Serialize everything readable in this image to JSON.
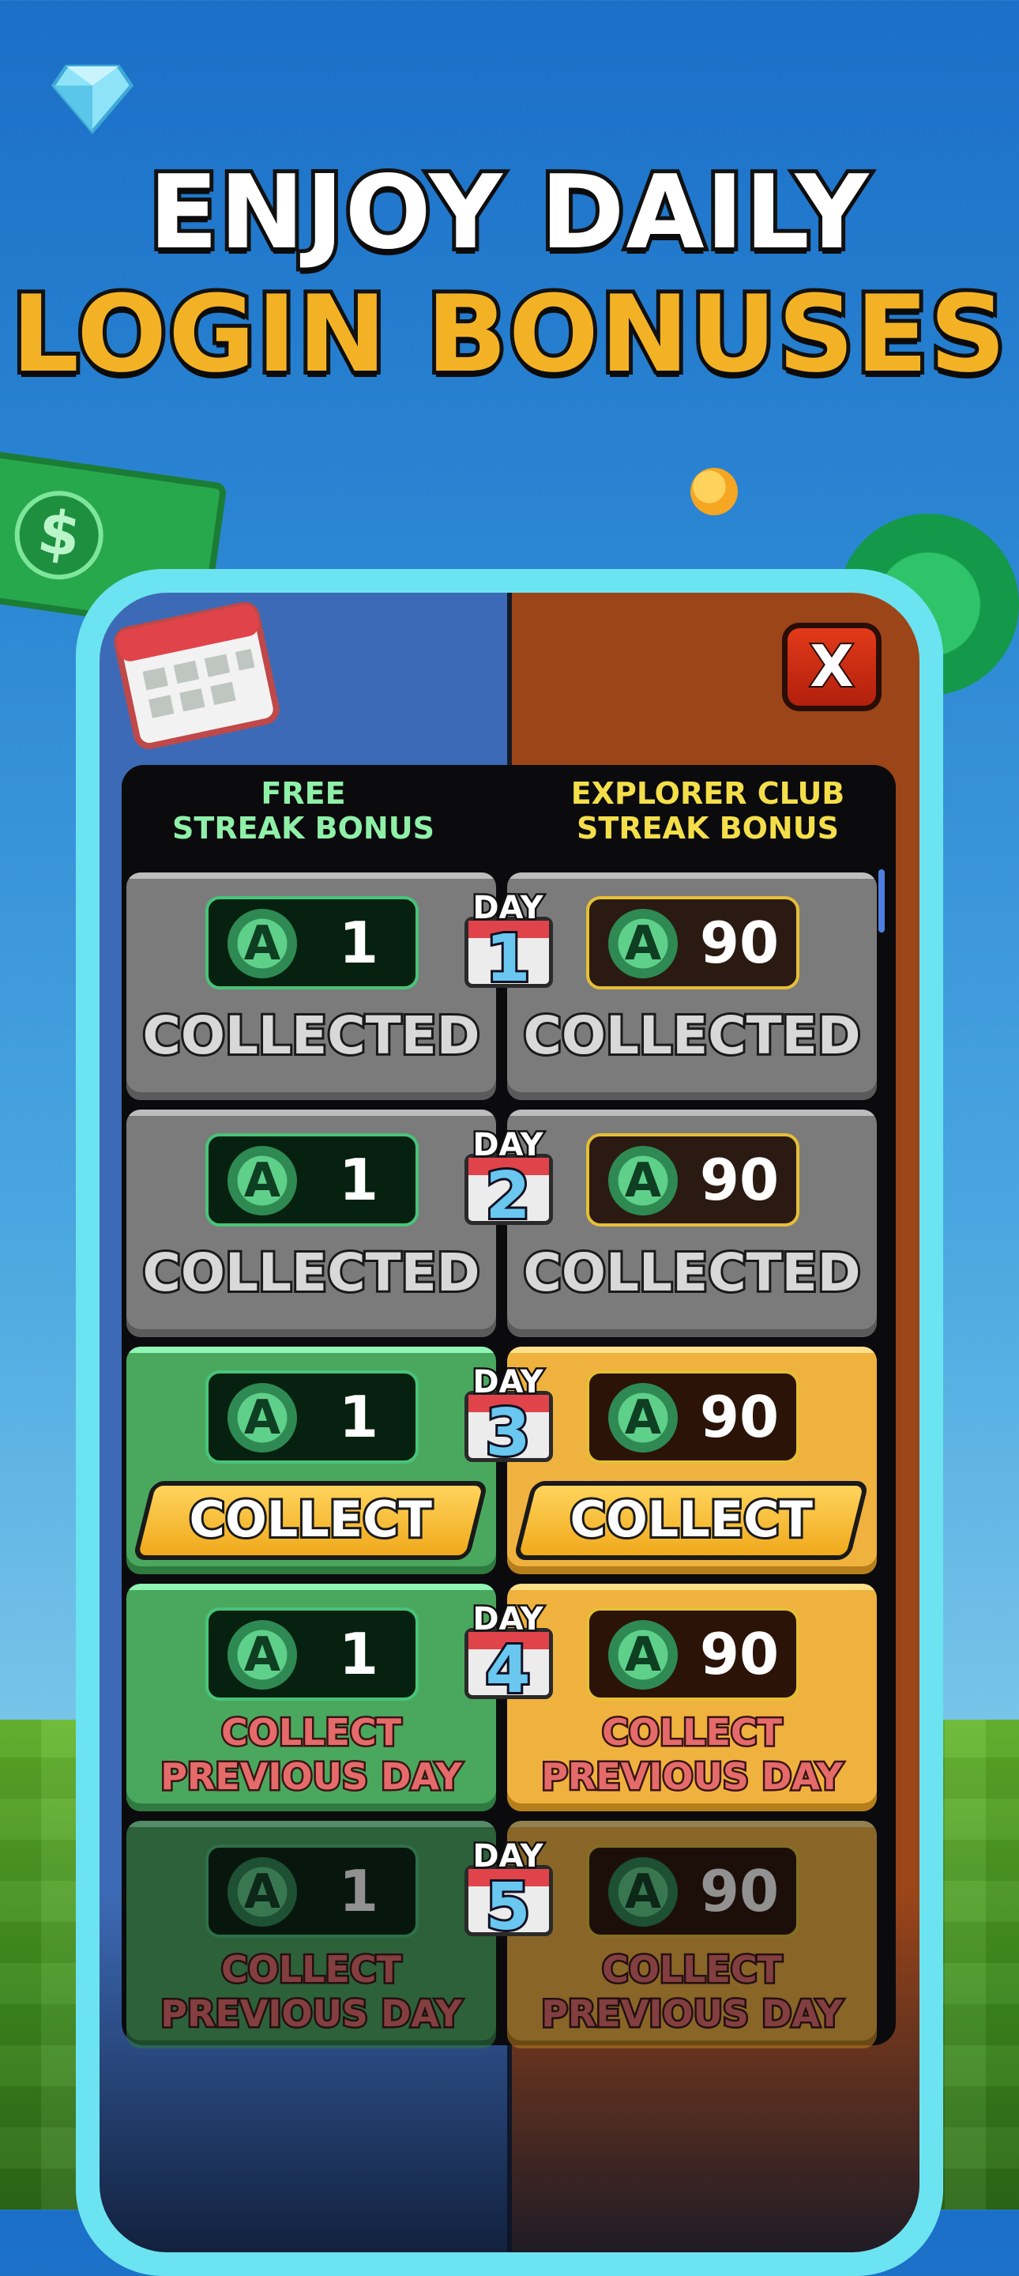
{
  "headline": {
    "line1": "ENJOY DAILY",
    "line2": "LOGIN BONUSES"
  },
  "colors": {
    "accent_gold": "#f3b225",
    "free_head": "#8ff0a8",
    "club_head": "#f4de4a",
    "phone_frame": "#6ce3f0"
  },
  "close_button": {
    "label": "X"
  },
  "columns": {
    "free": "FREE\nSTREAK BONUS",
    "club": "EXPLORER CLUB\nSTREAK BONUS"
  },
  "icons": {
    "token": "A",
    "bill": "$"
  },
  "days": [
    {
      "day_label": "DAY",
      "day_num": "1",
      "free_amount": "1",
      "club_amount": "90",
      "free_status": "COLLECTED",
      "club_status": "COLLECTED"
    },
    {
      "day_label": "DAY",
      "day_num": "2",
      "free_amount": "1",
      "club_amount": "90",
      "free_status": "COLLECTED",
      "club_status": "COLLECTED"
    },
    {
      "day_label": "DAY",
      "day_num": "3",
      "free_amount": "1",
      "club_amount": "90",
      "free_status": "COLLECT",
      "club_status": "COLLECT"
    },
    {
      "day_label": "DAY",
      "day_num": "4",
      "free_amount": "1",
      "club_amount": "90",
      "free_status": "COLLECT\nPREVIOUS DAY",
      "club_status": "COLLECT\nPREVIOUS DAY"
    },
    {
      "day_label": "DAY",
      "day_num": "5",
      "free_amount": "1",
      "club_amount": "90",
      "free_status": "COLLECT\nPREVIOUS DAY",
      "club_status": "COLLECT\nPREVIOUS DAY"
    }
  ]
}
